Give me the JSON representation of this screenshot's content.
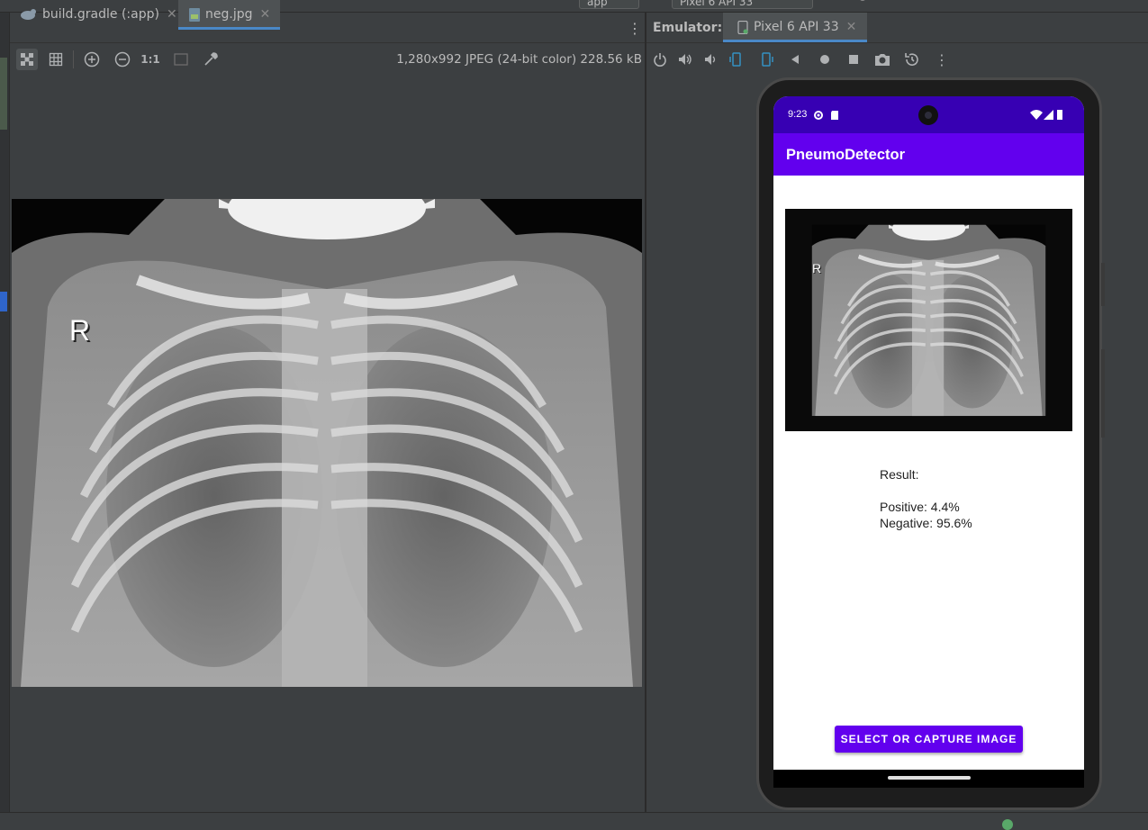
{
  "toolbar_top": {
    "run_config": "app",
    "device_select": "Pixel 6 API 33"
  },
  "editor": {
    "tabs": [
      {
        "label": "build.gradle (:app)",
        "icon": "gradle-icon",
        "active": false
      },
      {
        "label": "neg.jpg",
        "icon": "image-file-icon",
        "active": true
      }
    ],
    "image_info": "1,280x992 JPEG (24-bit color) 228.56 kB",
    "zoom_actual_label": "1:1",
    "xray_marker": "R"
  },
  "emulator": {
    "title": "Emulator:",
    "device_tab": "Pixel 6 API 33"
  },
  "phone": {
    "status_time": "9:23",
    "app_title": "PneumoDetector",
    "result_heading": "Result:",
    "positive_text": "Positive: 4.4%",
    "negative_text": "Negative: 95.6%",
    "action_button": "SELECT OR CAPTURE IMAGE",
    "xray_marker": "R"
  },
  "colors": {
    "ide_bg": "#3c3f41",
    "tab_active_underline": "#4a88c7",
    "app_primary": "#6200ee",
    "app_primary_dark": "#3700b3"
  }
}
